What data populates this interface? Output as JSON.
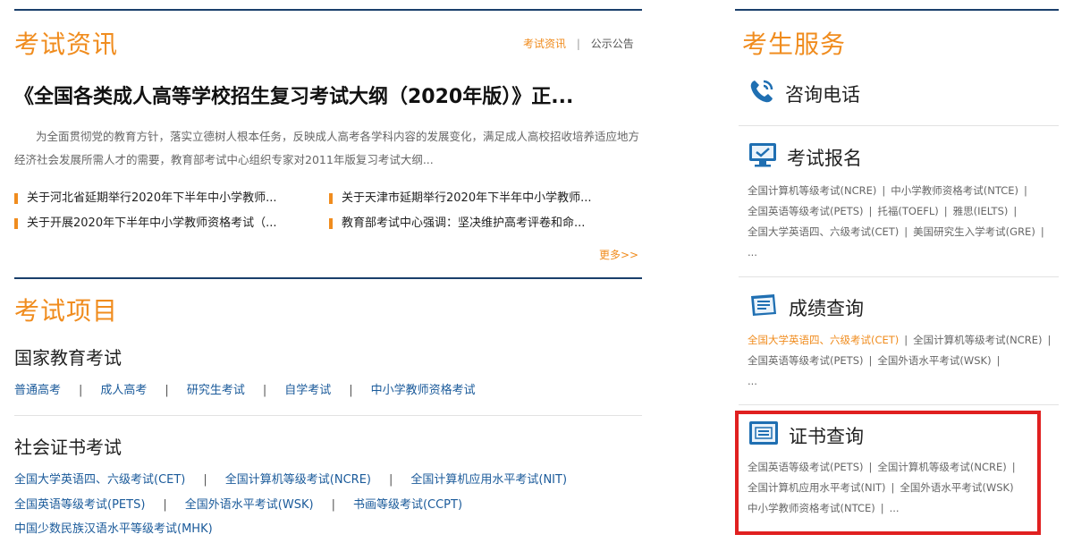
{
  "exam_news": {
    "title": "考试资讯",
    "tabs": [
      "考试资讯",
      "公示公告"
    ],
    "headline": "《全国各类成人高等学校招生复习考试大纲（2020年版）》正...",
    "summary": "为全面贯彻党的教育方针，落实立德树人根本任务，反映成人高考各学科内容的发展变化，满足成人高校招收培养适应地方经济社会发展所需人才的需要，教育部考试中心组织专家对2011年版复习考试大纲...",
    "items": [
      "关于河北省延期举行2020年下半年中小学教师...",
      "关于天津市延期举行2020年下半年中小学教师...",
      "关于开展2020年下半年中小学教师资格考试（...",
      "教育部考试中心强调：坚决维护高考评卷和命..."
    ],
    "more": "更多>>"
  },
  "exam_projects": {
    "title": "考试项目",
    "national": {
      "title": "国家教育考试",
      "links": [
        "普通高考",
        "成人高考",
        "研究生考试",
        "自学考试",
        "中小学教师资格考试"
      ]
    },
    "social": {
      "title": "社会证书考试",
      "row1": [
        "全国大学英语四、六级考试(CET)",
        "全国计算机等级考试(NCRE)",
        "全国计算机应用水平考试(NIT)"
      ],
      "row2": [
        "全国英语等级考试(PETS)",
        "全国外语水平考试(WSK)",
        "书画等级考试(CCPT)"
      ],
      "row3": [
        "中国少数民族汉语水平等级考试(MHK)"
      ]
    }
  },
  "services": {
    "title": "考生服务",
    "consult": {
      "label": "咨询电话",
      "icon": "phone-icon"
    },
    "register": {
      "label": "考试报名",
      "icon": "monitor-icon",
      "lines": [
        [
          "全国计算机等级考试(NCRE)",
          "中小学教师资格考试(NTCE)"
        ],
        [
          "全国英语等级考试(PETS)",
          "托福(TOEFL)",
          "雅思(IELTS)"
        ],
        [
          "全国大学英语四、六级考试(CET)",
          "美国研究生入学考试(GRE)"
        ]
      ],
      "ellipsis": "..."
    },
    "scores": {
      "label": "成绩查询",
      "icon": "score-sheet-icon",
      "lines": [
        [
          "全国大学英语四、六级考试(CET)",
          "全国计算机等级考试(NCRE)"
        ],
        [
          "全国英语等级考试(PETS)",
          "全国外语水平考试(WSK)"
        ]
      ],
      "ellipsis": "..."
    },
    "certificates": {
      "label": "证书查询",
      "icon": "certificate-icon",
      "lines": [
        [
          "全国英语等级考试(PETS)",
          "全国计算机等级考试(NCRE)"
        ],
        [
          "全国计算机应用水平考试(NIT)",
          "全国外语水平考试(WSK)"
        ],
        [
          "中小学教师资格考试(NTCE)",
          "..."
        ]
      ]
    }
  },
  "colors": {
    "accent": "#f08c1e",
    "navy": "#1a3f6b",
    "link": "#1a5a9a",
    "highlight_box": "#e02020"
  }
}
